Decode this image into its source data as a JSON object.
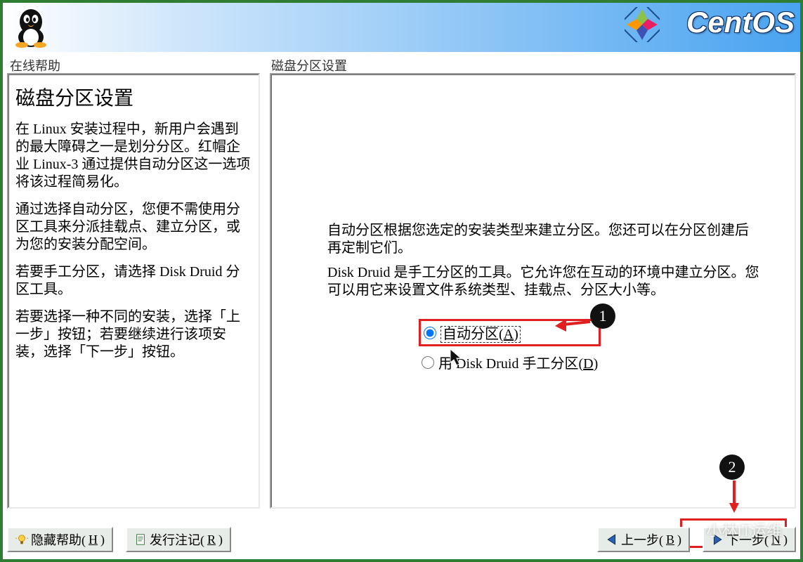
{
  "brand": "CentOS",
  "help": {
    "section_label": "在线帮助",
    "title": "磁盘分区设置",
    "p1": "在 Linux 安装过程中，新用户会遇到的最大障碍之一是划分分区。红帽企业 Linux-3 通过提供自动分区这一选项将该过程简易化。",
    "p2": "通过选择自动分区，您便不需使用分区工具来分派挂载点、建立分区，或为您的安装分配空间。",
    "p3": "若要手工分区，请选择 Disk Druid 分区工具。",
    "p4": "若要选择一种不同的安装，选择「上一步」按钮；若要继续进行该项安装，选择「下一步」按钮。"
  },
  "main": {
    "section_label": "磁盘分区设置",
    "p1": "自动分区根据您选定的安装类型来建立分区。您还可以在分区创建后再定制它们。",
    "p2": "Disk Druid 是手工分区的工具。它允许您在互动的环境中建立分区。您可以用它来设置文件系统类型、挂载点、分区大小等。",
    "radios": {
      "auto": {
        "label_pre": "自动分区(",
        "ak": "A",
        "label_post": ")"
      },
      "manual": {
        "label_pre": "用 Disk Druid 手工分区(",
        "ak": "D",
        "label_post": ")"
      }
    }
  },
  "buttons": {
    "hide_help": {
      "label_pre": "隐藏帮助(",
      "ak": "H",
      "label_post": ")"
    },
    "release_notes": {
      "label_pre": "发行注记(",
      "ak": "R",
      "label_post": ")"
    },
    "back": {
      "label_pre": "上一步(",
      "ak": "B",
      "label_post": ")"
    },
    "next": {
      "label_pre": "下一步(",
      "ak": "N",
      "label_post": ")"
    }
  },
  "callouts": {
    "one": "1",
    "two": "2"
  },
  "watermark": "小林IT运维"
}
